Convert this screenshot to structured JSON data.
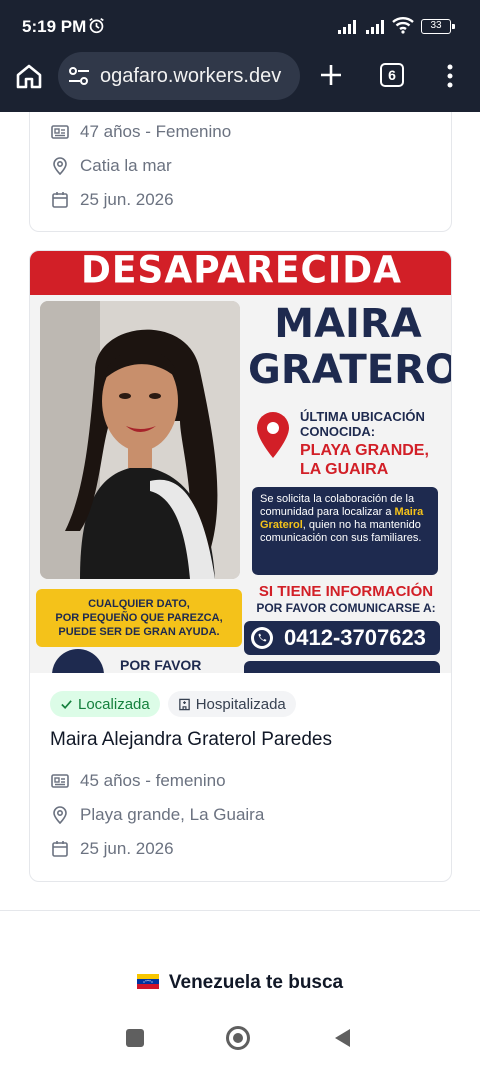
{
  "status_bar": {
    "time": "5:19 PM",
    "battery": "33"
  },
  "browser": {
    "url": "ogafaro.workers.dev",
    "tab_count": "6"
  },
  "card_previous": {
    "age_gender": "47 años - Femenino",
    "location": "Catia la mar",
    "date": "25 jun. 2026"
  },
  "poster": {
    "banner": "DESAPARECIDA",
    "name_line1": "MAIRA",
    "name_line2": "GRATEROL",
    "last_location_label_1": "ÚLTIMA UBICACIÓN",
    "last_location_label_2": "CONOCIDA:",
    "last_location_value_1": "PLAYA GRANDE,",
    "last_location_value_2": "LA GUAIRA",
    "info_1": "Se solicita la colaboración de la comunidad para localizar a ",
    "info_name": "Maira Graterol",
    "info_2": ", quien no ha mantenido comunicación con sus familiares.",
    "yellow_1": "CUALQUIER DATO,",
    "yellow_2": "POR PEQUEÑO QUE PAREZCA,",
    "yellow_3": "PUEDE SER DE GRAN AYUDA.",
    "contact_title": "SI TIENE INFORMACIÓN",
    "contact_sub": "POR FAVOR COMUNICARSE A:",
    "phone": "0412-3707623",
    "por_favor": "POR FAVOR"
  },
  "card_current": {
    "status_badge": "Localizada",
    "condition_badge": "Hospitalizada",
    "name": "Maira Alejandra Graterol Paredes",
    "age_gender": "45 años - femenino",
    "location": "Playa grande, La Guaira",
    "date": "25 jun. 2026"
  },
  "footer": {
    "text": "Venezuela te busca"
  },
  "colors": {
    "chrome_bg": "#1b2231",
    "accent_green": "#15803d",
    "poster_red": "#d21f27",
    "poster_navy": "#1e2a4f"
  }
}
